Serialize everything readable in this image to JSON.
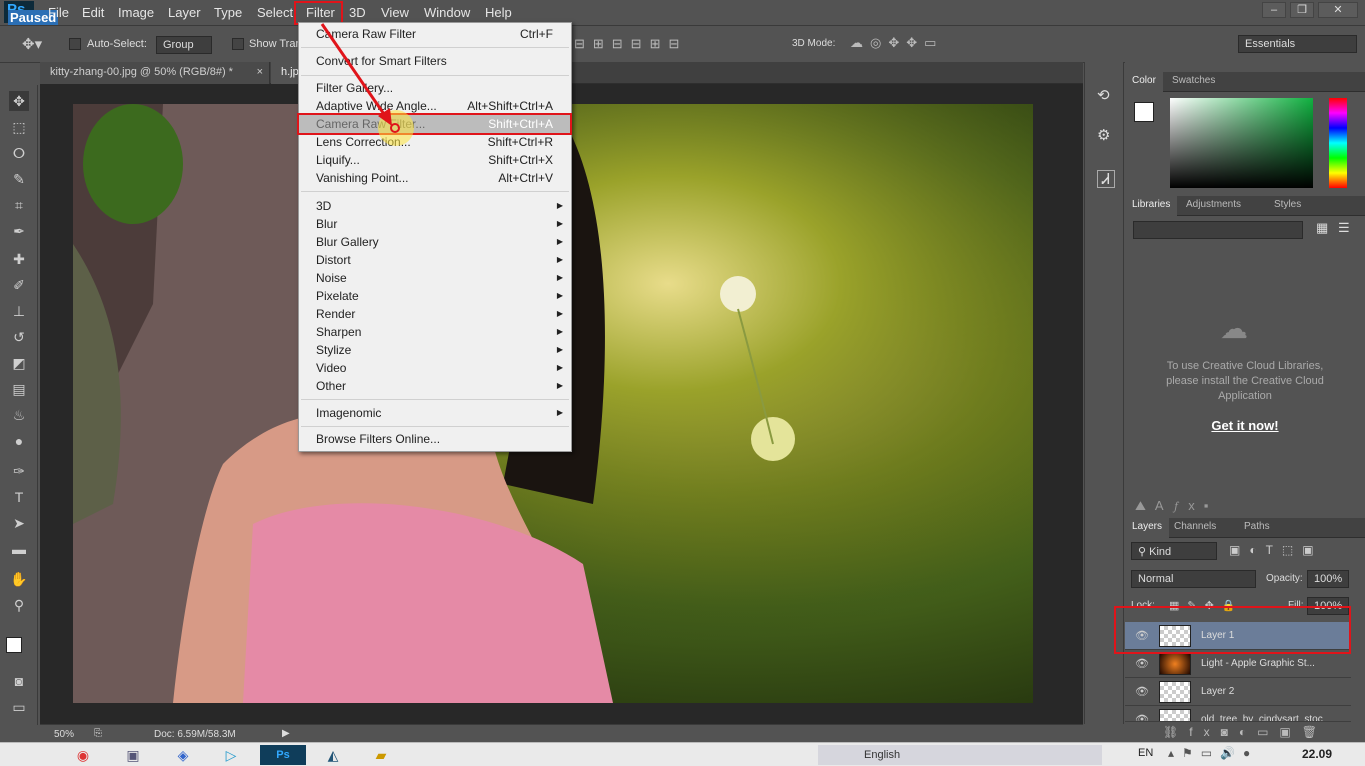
{
  "app": {
    "logo": "Ps",
    "paused": "Paused",
    "window_controls": [
      "–",
      "❐",
      "✕"
    ]
  },
  "menubar": [
    "File",
    "Edit",
    "Image",
    "Layer",
    "Type",
    "Select",
    "Filter",
    "3D",
    "View",
    "Window",
    "Help"
  ],
  "options": {
    "auto_select": "Auto-Select:",
    "group": "Group",
    "show_transform": "Show Tran",
    "mode3d": "3D Mode:",
    "workspace": "Essentials"
  },
  "tabs": [
    {
      "label": "kitty-zhang-00.jpg @ 50% (RGB/8#) *",
      "close": "×"
    },
    {
      "label": "h.jp"
    }
  ],
  "filter_menu": {
    "top": [
      {
        "label": "Camera Raw Filter",
        "sc": "Ctrl+F"
      },
      {
        "label": "Convert for Smart Filters",
        "sc": ""
      }
    ],
    "mid": [
      {
        "label": "Filter Gallery...",
        "sc": ""
      },
      {
        "label": "Adaptive Wide Angle...",
        "sc": "Alt+Shift+Ctrl+A"
      },
      {
        "label": "Camera Raw Filter...",
        "sc": "Shift+Ctrl+A"
      },
      {
        "label": "Lens Correction...",
        "sc": "Shift+Ctrl+R"
      },
      {
        "label": "Liquify...",
        "sc": "Shift+Ctrl+X"
      },
      {
        "label": "Vanishing Point...",
        "sc": "Alt+Ctrl+V"
      }
    ],
    "subs": [
      "3D",
      "Blur",
      "Blur Gallery",
      "Distort",
      "Noise",
      "Pixelate",
      "Render",
      "Sharpen",
      "Stylize",
      "Video",
      "Other"
    ],
    "imagenomic": "Imagenomic",
    "browse": "Browse Filters Online..."
  },
  "status": {
    "zoom": "50%",
    "doc": "Doc: 6.59M/58.3M"
  },
  "color_panel": {
    "tabs": [
      "Color",
      "Swatches"
    ],
    "accent": "#10b040"
  },
  "libraries": {
    "tabs": [
      "Libraries",
      "Adjustments",
      "Styles"
    ],
    "msg1": "To use Creative Cloud Libraries,",
    "msg2": "please install the Creative Cloud",
    "msg3": "Application",
    "link": "Get it now!"
  },
  "layers_panel": {
    "tabs": [
      "Layers",
      "Channels",
      "Paths"
    ],
    "kind": "Kind",
    "blend": "Normal",
    "opacity_label": "Opacity:",
    "opacity": "100%",
    "lock": "Lock:",
    "fill_label": "Fill:",
    "fill": "100%",
    "layers": [
      "Layer 1",
      "Light - Apple Graphic St...",
      "Layer 2",
      "old_tree_by_cindysart_stoc"
    ]
  },
  "taskbar": {
    "lang": "EN",
    "english": "English",
    "clock": "22.09"
  }
}
